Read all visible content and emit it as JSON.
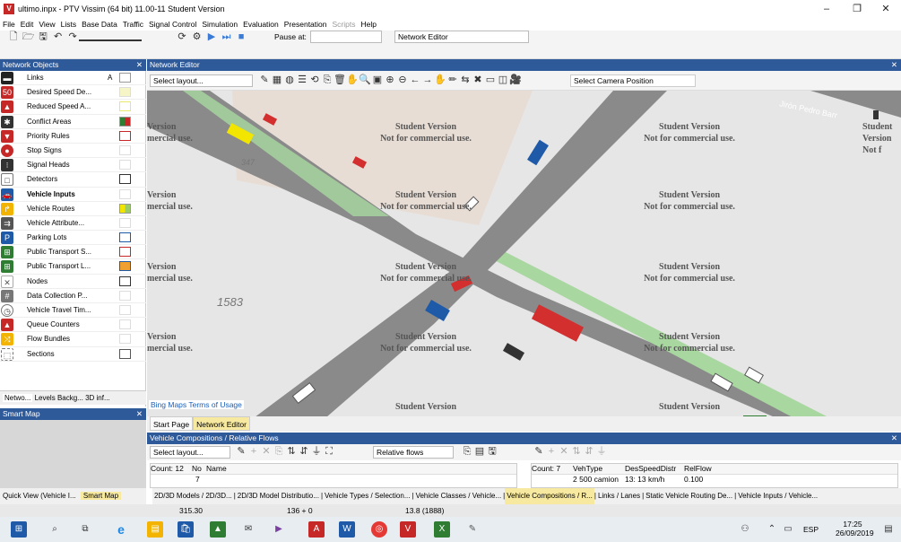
{
  "window": {
    "title": "ultimo.inpx - PTV Vissim (64 bit) 11.00-11 Student Version",
    "controls": [
      "–",
      "❐",
      "✕"
    ]
  },
  "menu": {
    "items": [
      "File",
      "Edit",
      "View",
      "Lists",
      "Base Data",
      "Traffic",
      "Signal Control",
      "Simulation",
      "Evaluation",
      "Presentation"
    ],
    "disabled_items": [
      "Scripts"
    ],
    "last_item": "Help"
  },
  "toolbar": {
    "pause_label": "Pause at:",
    "pause_value": "",
    "editor_select": "Network Editor"
  },
  "network_objects": {
    "title": "Network Objects",
    "items": [
      {
        "label": "Links",
        "color": "#ffffff"
      },
      {
        "label": "Desired Speed De...",
        "color": "#ffffff"
      },
      {
        "label": "Reduced Speed A...",
        "color": "#ffffff"
      },
      {
        "label": "Conflict Areas",
        "color": "#ffffff"
      },
      {
        "label": "Priority Rules",
        "color": "#ffffff"
      },
      {
        "label": "Stop Signs",
        "color": "#ffffff"
      },
      {
        "label": "Signal Heads",
        "color": "#ffffff"
      },
      {
        "label": "Detectors",
        "color": "#ffffff"
      },
      {
        "label": "Vehicle Inputs",
        "color": "#ffffff",
        "selected": true
      },
      {
        "label": "Vehicle Routes",
        "color": "#ffffff"
      },
      {
        "label": "Vehicle Attribute...",
        "color": "#ffffff"
      },
      {
        "label": "Parking Lots",
        "color": "#ffffff"
      },
      {
        "label": "Public Transport S...",
        "color": "#ffffff"
      },
      {
        "label": "Public Transport L...",
        "color": "#ffffff"
      },
      {
        "label": "Nodes",
        "color": "#ffffff"
      },
      {
        "label": "Data Collection P...",
        "color": "#ffffff"
      },
      {
        "label": "Vehicle Travel Tim...",
        "color": "#ffffff"
      },
      {
        "label": "Queue Counters",
        "color": "#ffffff"
      },
      {
        "label": "Flow Bundles",
        "color": "#ffffff"
      },
      {
        "label": "Sections",
        "color": "#ffffff"
      }
    ],
    "links_label": "A",
    "tabs": [
      "Netwo...",
      "Levels",
      "Backg...",
      "3D inf..."
    ]
  },
  "smart_map": {
    "title": "Smart Map",
    "tabs": [
      "Quick View (Vehicle I...",
      "Smart Map"
    ]
  },
  "network_editor": {
    "title": "Network Editor",
    "layout_select": "Select layout...",
    "camera_select": "Select Camera Position",
    "watermark_title": "Student Version",
    "watermark_sub": "Not for commercial use.",
    "watermark_left_title": "Version",
    "watermark_left_sub": "mercial use.",
    "watermark_right_title": "Student Version",
    "watermark_right_sub": "Not f",
    "map_label": "1583",
    "map_label2": "347",
    "street_label": "Jirón Pedro Barr",
    "bing_link": "Bing Maps Terms of Usage"
  },
  "doc_tabs": [
    "Start Page",
    "Network Editor"
  ],
  "vehicle_compositions": {
    "title": "Vehicle Compositions / Relative Flows",
    "layout_select": "Select layout...",
    "relative_select": "Relative flows",
    "left_header": [
      "Count: 12",
      "No",
      "Name"
    ],
    "right_header": [
      "Count: 7",
      "VehType",
      "DesSpeedDistr",
      "RelFlow"
    ],
    "left_row": "7",
    "right_row": [
      "2 500 camion",
      "13: 13 km/h",
      "0.100"
    ]
  },
  "bottom_tabs": [
    "2D/3D Models / 2D/3D...",
    "2D/3D Model Distributio...",
    "Vehicle Types / Selection...",
    "Vehicle Classes / Vehicle...",
    "Vehicle Compositions / R...",
    "Links / Lanes",
    "Static Vehicle Routing De...",
    "Vehicle Inputs / Vehicle..."
  ],
  "status": {
    "coord_x": "315.30",
    "coord_y": "136 + 0",
    "time": "13.8 (1888)"
  },
  "taskbar": {
    "lang": "ESP",
    "time": "17:25",
    "date": "26/09/2019"
  }
}
